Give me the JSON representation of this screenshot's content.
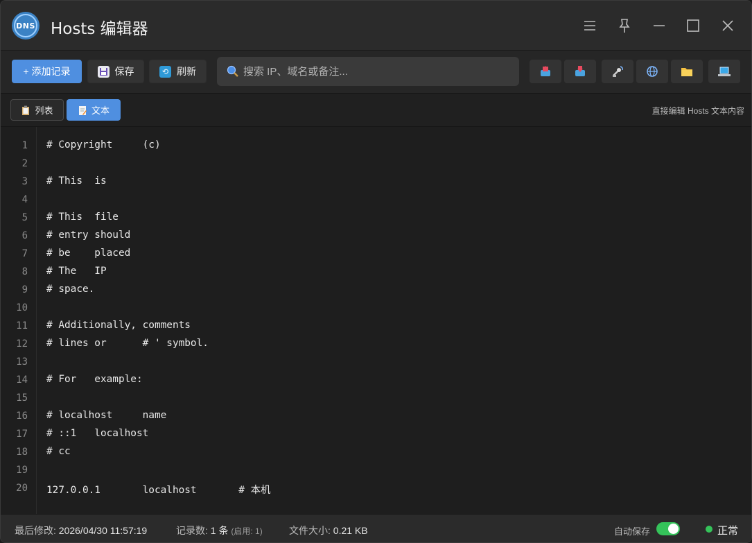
{
  "app": {
    "logo_text": "DNS",
    "title": "Hosts 编辑器"
  },
  "toolbar": {
    "add_label": "+ 添加记录",
    "save_label": "保存",
    "refresh_label": "刷新",
    "search_placeholder": "搜索 IP、域名或备注...",
    "tool_icons": [
      "export-icon",
      "import-icon",
      "satellite-icon",
      "globe-icon",
      "folder-icon",
      "laptop-icon"
    ]
  },
  "viewbar": {
    "list_tab": "列表",
    "text_tab": "文本",
    "hint": "直接编辑 Hosts 文本内容"
  },
  "editor": {
    "line_numbers": [
      "1",
      "2",
      "3",
      "4",
      "5",
      "6",
      "7",
      "8",
      "9",
      "10",
      "11",
      "12",
      "13",
      "14",
      "15",
      "16",
      "17",
      "18",
      "19",
      "20"
    ],
    "lines": [
      "# Copyright     (c)",
      "",
      "# This  is",
      "",
      "# This  file",
      "# entry should",
      "# be    placed",
      "# The   IP",
      "# space.",
      "",
      "# Additionally, comments",
      "# lines or      # ' symbol.",
      "",
      "# For   example:",
      "",
      "# localhost     name",
      "# ::1   localhost",
      "# cc",
      "",
      "127.0.0.1       localhost       # 本机"
    ]
  },
  "status": {
    "modified_label": "最后修改:",
    "modified_value": "2026/04/30 11:57:19",
    "records_label": "记录数:",
    "records_value": "1 条",
    "records_enabled": "(启用: 1)",
    "size_label": "文件大小:",
    "size_value": "0.21 KB",
    "autosave_label": "自动保存",
    "autosave_on": true,
    "state_label": "正常"
  },
  "colors": {
    "accent": "#4f8fe0",
    "ok": "#35c35a",
    "background": "#1e1e1e"
  }
}
